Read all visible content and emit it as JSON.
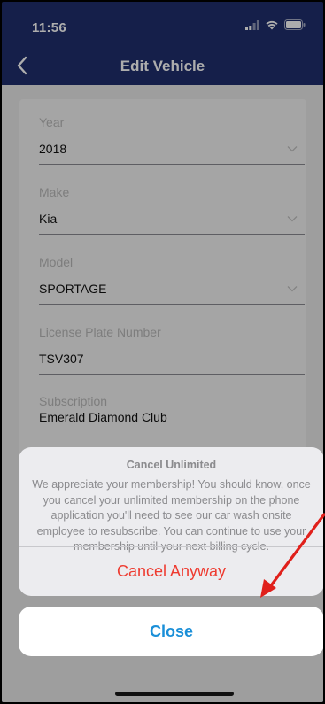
{
  "status_bar": {
    "time": "11:56"
  },
  "nav": {
    "title": "Edit Vehicle"
  },
  "form": {
    "fields": [
      {
        "label": "Year",
        "value": "2018",
        "dropdown": true
      },
      {
        "label": "Make",
        "value": "Kia",
        "dropdown": true
      },
      {
        "label": "Model",
        "value": "SPORTAGE",
        "dropdown": true
      },
      {
        "label": "License Plate Number",
        "value": "TSV307",
        "dropdown": false
      },
      {
        "label": "Subscription",
        "value": "Emerald Diamond Club",
        "dropdown": false
      }
    ]
  },
  "action_sheet": {
    "title": "Cancel Unlimited",
    "message": "We appreciate your membership! You should know, once you cancel your unlimited membership on the phone application you'll need to see our car wash onsite employee to resubscribe. You can continue to use your membership until your next billing cycle.",
    "action_label": "Cancel Anyway",
    "close_label": "Close"
  },
  "colors": {
    "nav_background": "#1f2e6d",
    "destructive": "#ee3b30",
    "close_text": "#1a8fd8",
    "annotation_arrow": "#e0201b"
  },
  "icons": [
    "back-chevron-icon",
    "signal-icon",
    "wifi-icon",
    "battery-icon",
    "chevron-down-icon"
  ]
}
